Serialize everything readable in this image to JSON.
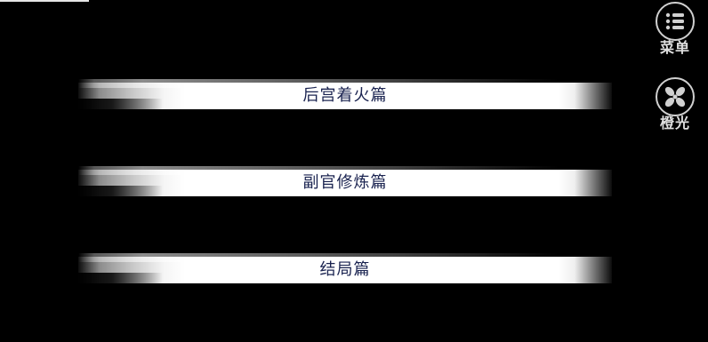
{
  "chapters": [
    {
      "label": "后宫着火篇"
    },
    {
      "label": "副官修炼篇"
    },
    {
      "label": "结局篇"
    }
  ],
  "side_buttons": {
    "menu": {
      "label": "菜单",
      "icon": "list-menu-icon"
    },
    "light": {
      "label": "橙光",
      "icon": "pinwheel-icon"
    }
  },
  "colors": {
    "background": "#000000",
    "chapter_text": "#1a2350",
    "button_text": "#e0e0e0"
  }
}
